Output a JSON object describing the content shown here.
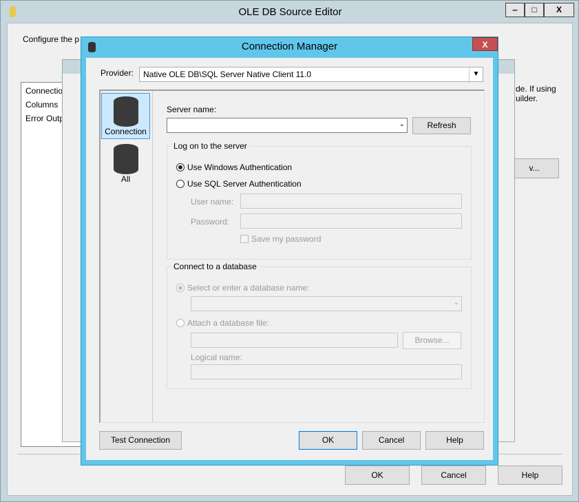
{
  "outer": {
    "title": "OLE DB Source Editor",
    "intro": "Configure the p",
    "nav": [
      "Connectio",
      "Columns",
      "Error Outp"
    ],
    "right_text1": "de. If using",
    "right_text2": "uilder.",
    "new_button": "v...",
    "ok": "OK",
    "cancel": "Cancel",
    "help": "Help",
    "min": "‒",
    "max": "□",
    "close": "X"
  },
  "cm": {
    "title": "Connection Manager",
    "close": "X",
    "provider_label": "Provider:",
    "provider_value": "Native OLE DB\\SQL Server Native Client 11.0",
    "pages": [
      {
        "label": "Connection",
        "icon": "database-plug-icon"
      },
      {
        "label": "All",
        "icon": "database-plug-wrench-icon"
      }
    ],
    "server_label": "Server name:",
    "server_value": "",
    "refresh": "Refresh",
    "logon_group": "Log on to the server",
    "win_auth": "Use Windows Authentication",
    "sql_auth": "Use SQL Server Authentication",
    "auth_selected": "windows",
    "user_label": "User name:",
    "user_value": "",
    "pwd_label": "Password:",
    "pwd_value": "",
    "save_pwd": "Save my password",
    "save_pwd_checked": false,
    "db_group": "Connect to a database",
    "select_db": "Select or enter a database name:",
    "db_value": "",
    "attach_db": "Attach a database file:",
    "attach_value": "",
    "browse": "Browse...",
    "logical_label": "Logical name:",
    "logical_value": "",
    "test": "Test Connection",
    "ok": "OK",
    "cancel": "Cancel",
    "help": "Help"
  },
  "colors": {
    "accent": "#61c6ea",
    "close_red": "#c75050",
    "selected_page": "#cce8ff"
  }
}
